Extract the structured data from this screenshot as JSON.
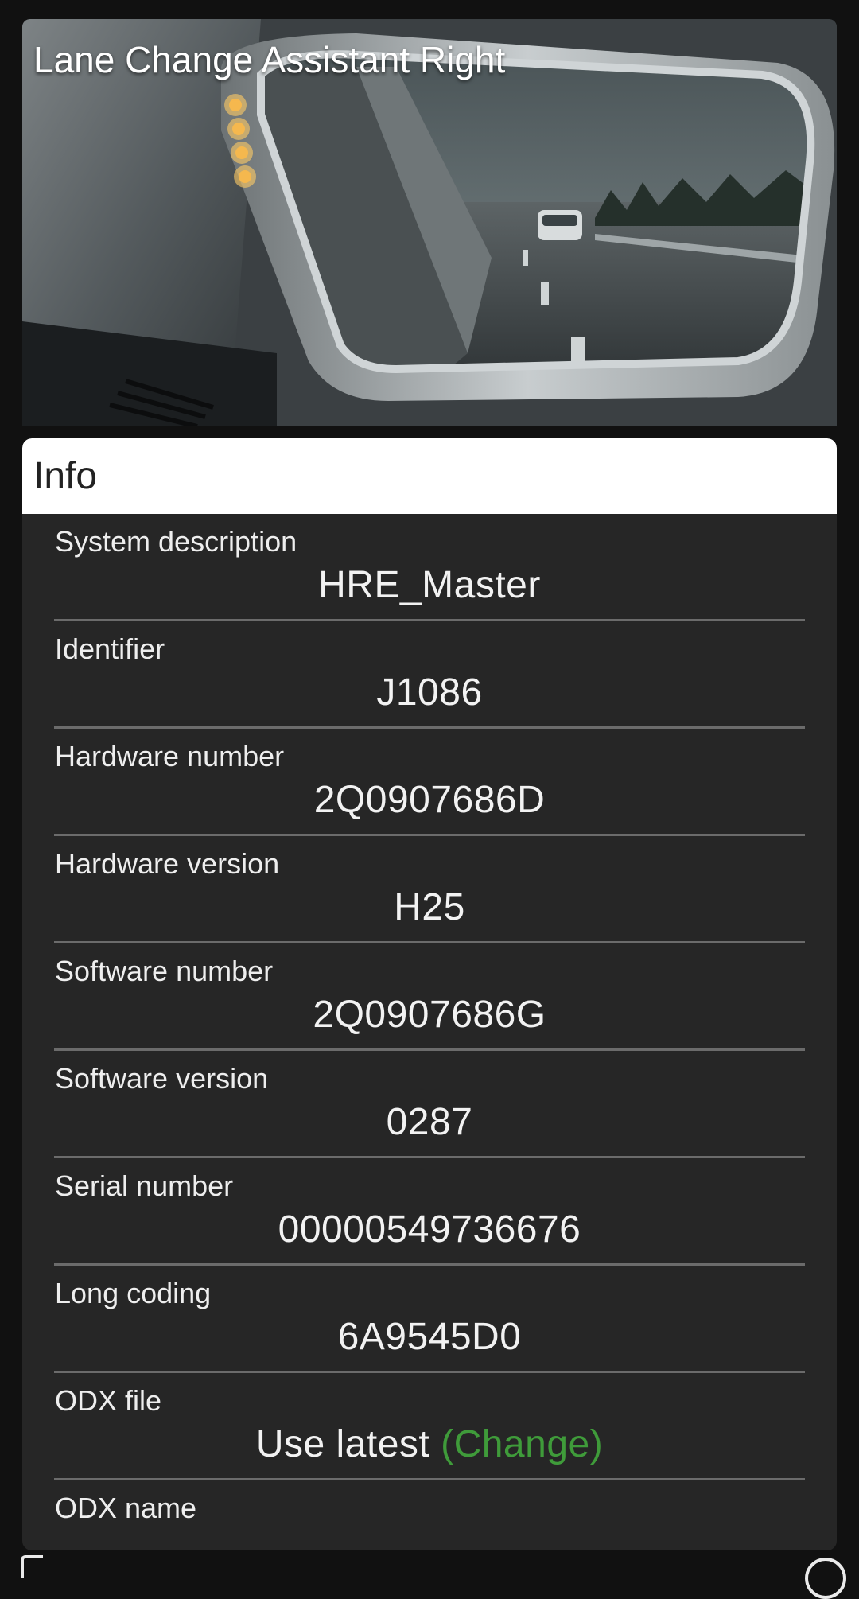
{
  "hero": {
    "title": "Lane Change Assistant Right",
    "image": "car-side-mirror-with-blind-spot-warning-lights"
  },
  "info": {
    "header": "Info",
    "rows": [
      {
        "label": "System description",
        "value": "HRE_Master"
      },
      {
        "label": "Identifier",
        "value": "J1086"
      },
      {
        "label": "Hardware number",
        "value": "2Q0907686D"
      },
      {
        "label": "Hardware version",
        "value": "H25"
      },
      {
        "label": "Software number",
        "value": "2Q0907686G"
      },
      {
        "label": "Software version",
        "value": "0287"
      },
      {
        "label": "Serial number",
        "value": "00000549736676"
      },
      {
        "label": "Long coding",
        "value": "6A9545D0"
      },
      {
        "label": "ODX file",
        "value": "Use latest",
        "action": "(Change)"
      },
      {
        "label": "ODX name",
        "value": ""
      }
    ]
  },
  "colors": {
    "background": "#111111",
    "card": "#262626",
    "header": "#ffffff",
    "accent_green": "#3f9b3a",
    "divider": "#6b6b6b"
  },
  "icons": {
    "bottom_left": "partial-nav-icon",
    "bottom_right": "partial-circle-icon"
  }
}
